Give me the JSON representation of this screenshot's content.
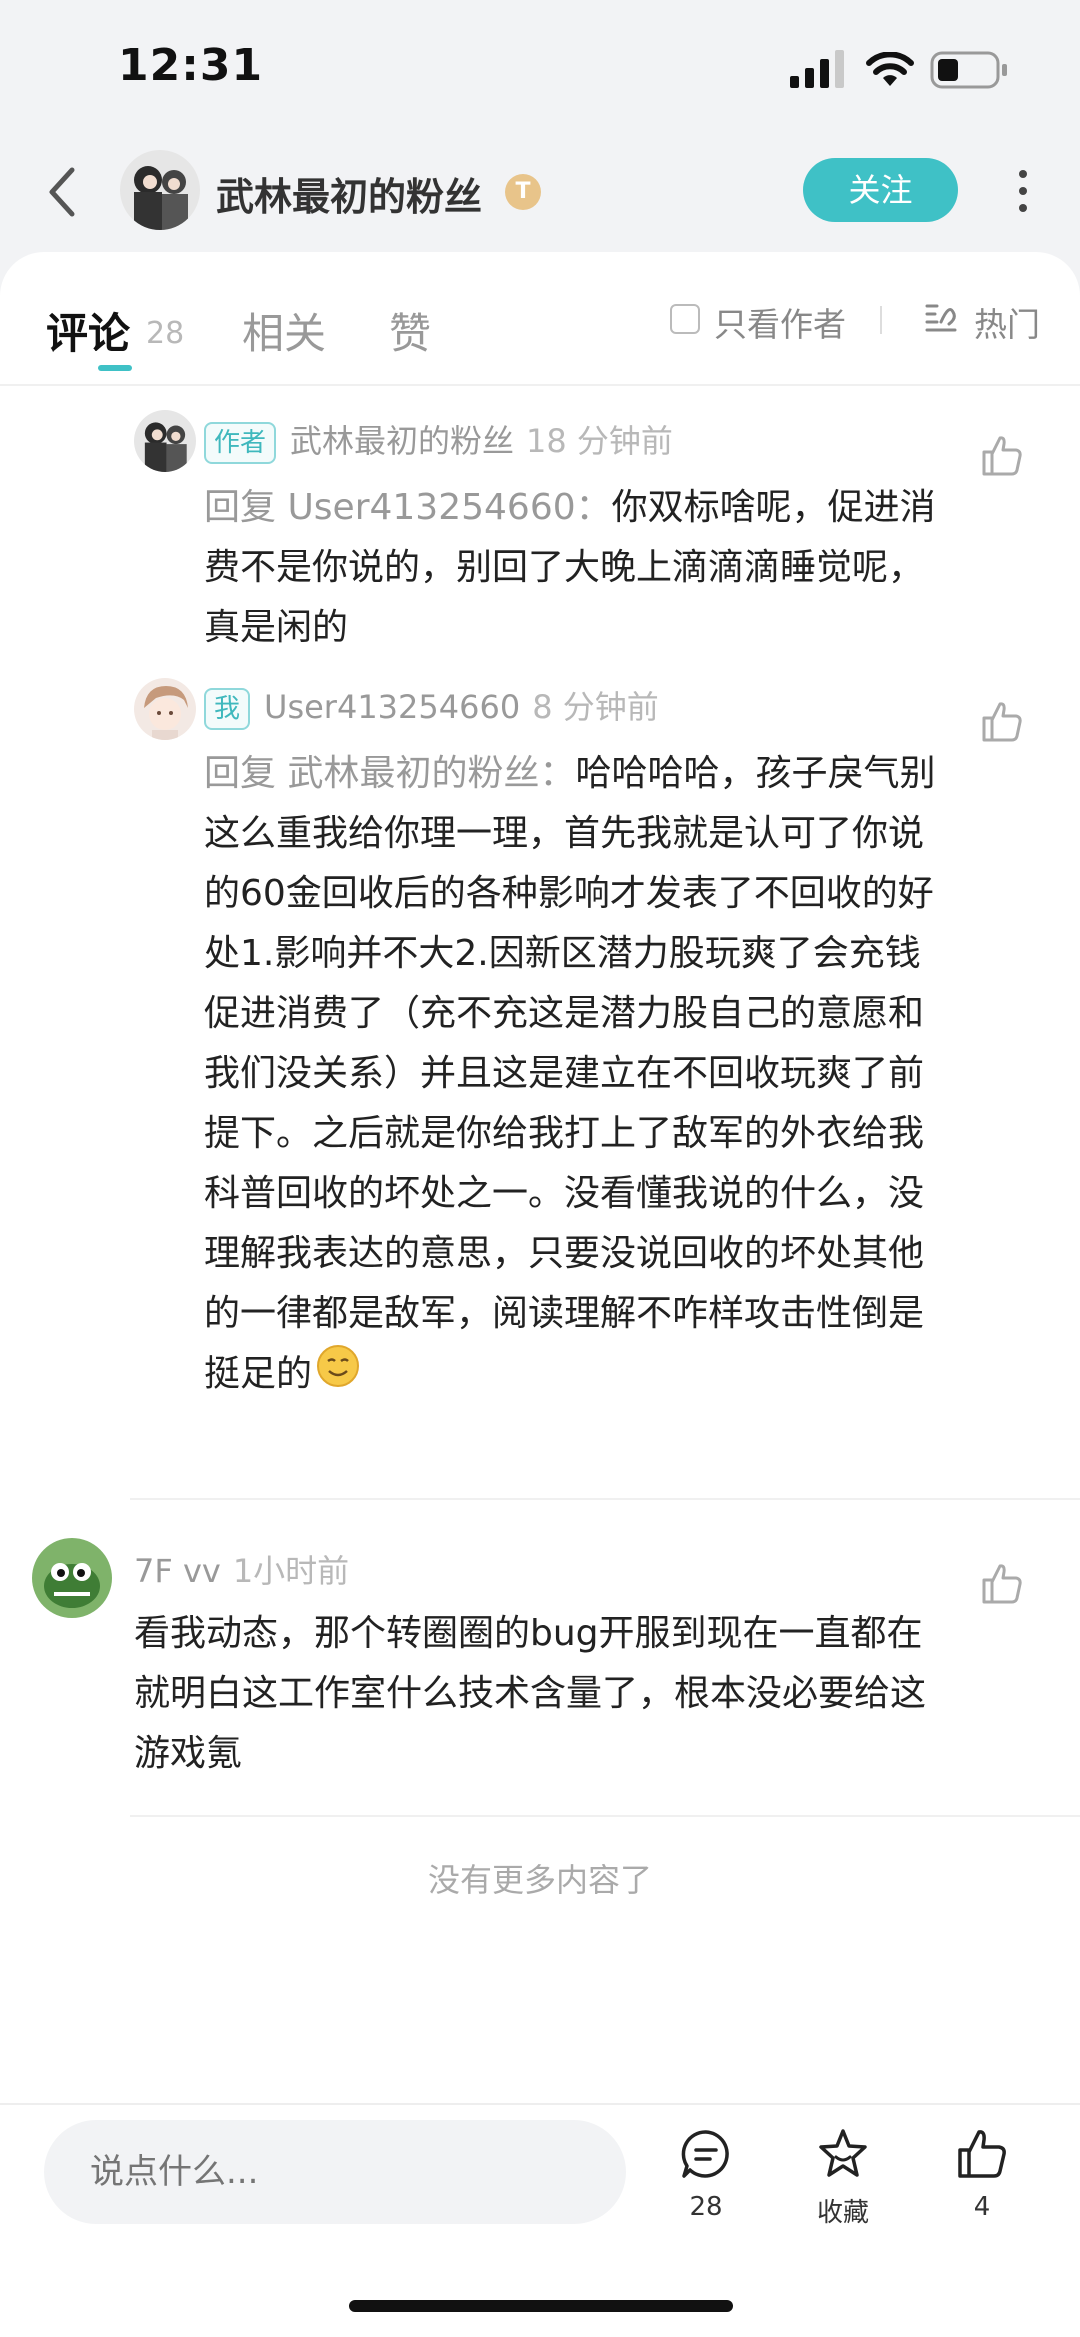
{
  "status_bar": {
    "time": "12:31"
  },
  "header": {
    "author_name": "武林最初的粉丝",
    "level_badge": "T",
    "follow_label": "关注"
  },
  "tabs": {
    "comments_label": "评论",
    "comments_count": "28",
    "related_label": "相关",
    "likes_label": "赞",
    "only_author_label": "只看作者",
    "sort_label": "热门"
  },
  "comments": [
    {
      "tag": "作者",
      "author": "武林最初的粉丝",
      "time": "18 分钟前",
      "reply_prefix": "回复 User413254660：",
      "text": "你双标啥呢，促进消费不是你说的，别回了大晚上滴滴滴睡觉呢，真是闲的"
    },
    {
      "tag": "我",
      "author": "User413254660",
      "time": "8 分钟前",
      "reply_prefix": "回复 武林最初的粉丝：",
      "text": "哈哈哈哈，孩子戾气别这么重我给你理一理，首先我就是认可了你说的60金回收后的各种影响才发表了不回收的好处1.影响并不大2.因新区潜力股玩爽了会充钱促进消费了（充不充这是潜力股自己的意愿和我们没关系）并且这是建立在不回收玩爽了前提下。之后就是你给我打上了敌军的外衣给我科普回收的坏处之一。没看懂我说的什么，没理解我表达的意思，只要没说回收的坏处其他的一律都是敌军，阅读理解不咋样攻击性倒是挺足的"
    },
    {
      "floor": "7F",
      "author": "vv",
      "time": "1小时前",
      "text": "看我动态，那个转圈圈的bug开服到现在一直都在就明白这工作室什么技术含量了，根本没必要给这游戏氪"
    }
  ],
  "footer_text": "没有更多内容了",
  "bottom_bar": {
    "input_placeholder": "说点什么...",
    "comment_count": "28",
    "favorite_label": "收藏",
    "like_count": "4"
  },
  "colors": {
    "accent": "#3fc1c6",
    "background": "#f2f3f5"
  }
}
